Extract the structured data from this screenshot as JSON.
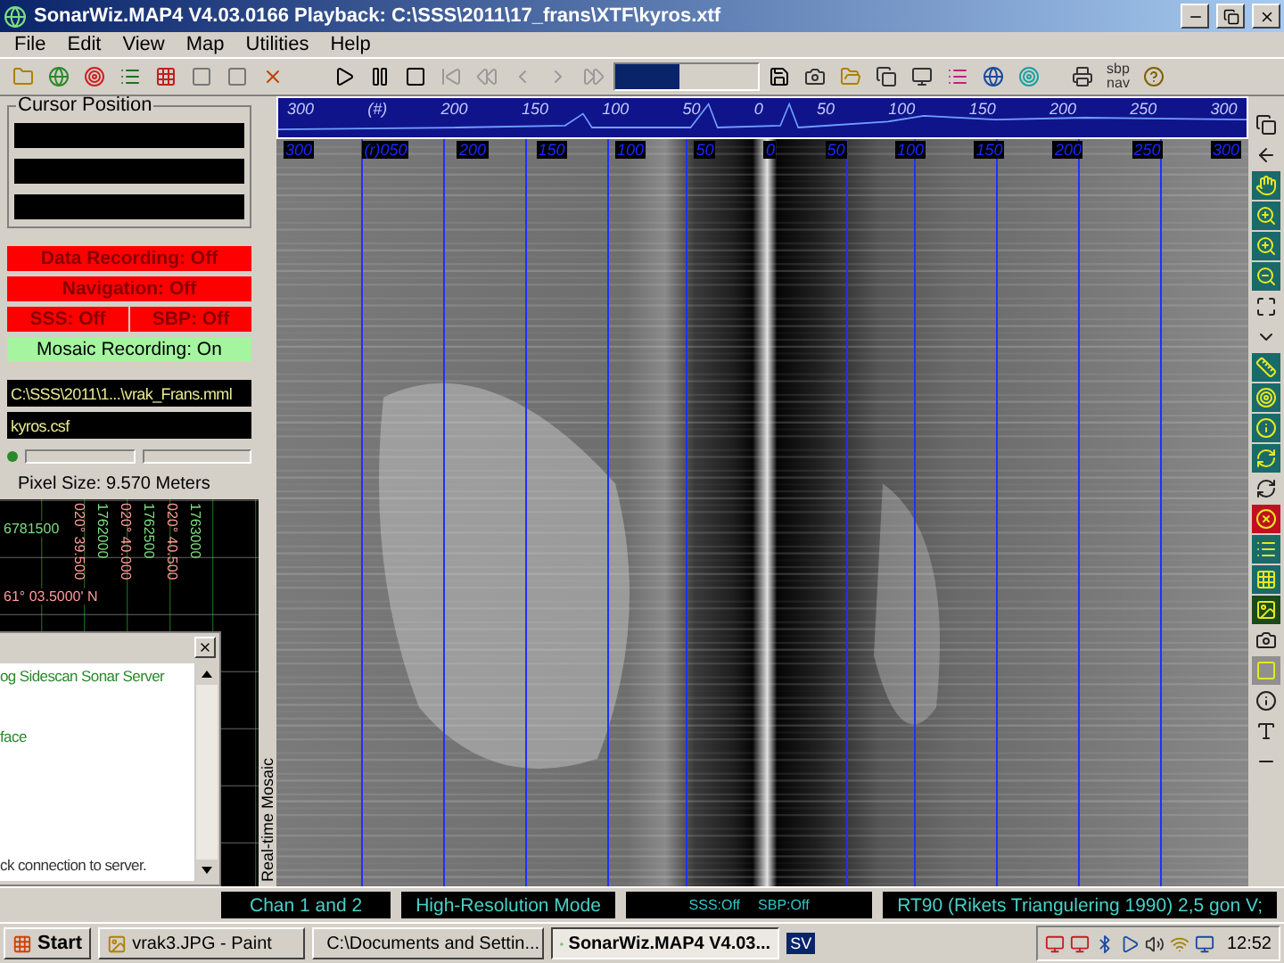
{
  "window": {
    "title": "SonarWiz.MAP4 V4.03.0166 Playback: C:\\SSS\\2011\\17_frans\\XTF\\kyros.xtf"
  },
  "menu": [
    "File",
    "Edit",
    "View",
    "Map",
    "Utilities",
    "Help"
  ],
  "toolbar": {
    "speed": {
      "level": 0.45
    },
    "sbp_nav": "sbp nav"
  },
  "waterfall": {
    "scale": [
      "300",
      "(#)",
      "200",
      "150",
      "100",
      "50",
      "0",
      "50",
      "100",
      "150",
      "200",
      "250",
      "300"
    ]
  },
  "sonar": {
    "scale": [
      "300",
      "(r)050",
      "200",
      "150",
      "100",
      "50",
      "0",
      "50",
      "100",
      "150",
      "200",
      "250",
      "300"
    ]
  },
  "cursor_position": {
    "title": "Cursor Position"
  },
  "status_rows": [
    {
      "cells": [
        {
          "label": "Data Recording: Off",
          "on": false
        }
      ]
    },
    {
      "cells": [
        {
          "label": "Navigation: Off",
          "on": false
        }
      ]
    },
    {
      "cells": [
        {
          "label": "SSS: Off",
          "on": false
        },
        {
          "label": "SBP: Off",
          "on": false
        }
      ]
    },
    {
      "cells": [
        {
          "label": "Mosaic Recording: On",
          "on": true
        }
      ]
    }
  ],
  "files": [
    "C:\\SSS\\2011\\1...\\vrak_Frans.mml",
    "kyros.csf"
  ],
  "progress": [
    {
      "level": 0
    },
    {
      "level": 0
    }
  ],
  "pixel_size": "Pixel Size: 9.570 Meters",
  "map": {
    "vertical_labels": [
      "020° 39.500",
      "1762000",
      "020° 40.000",
      "1762500",
      "020° 40.500",
      "1763000"
    ],
    "horizontal_labels": [
      "6781500",
      "61° 03.5000' N"
    ]
  },
  "dialog": {
    "lines": [
      "og Sidescan Sonar Server",
      "face",
      "ck connection to server."
    ]
  },
  "mosaic_tab": "Real-time Mosaic",
  "status_bar": [
    {
      "texts": [
        "Chan 1 and 2"
      ]
    },
    {
      "texts": [
        "High-Resolution Mode"
      ]
    },
    {
      "texts": [
        "SSS:Off",
        "SBP:Off"
      ]
    },
    {
      "texts": [
        "RT90 (Rikets Triangulering 1990) 2,5 gon V;"
      ]
    }
  ],
  "taskbar": {
    "start": "Start",
    "tasks": [
      {
        "label": "vrak3.JPG - Paint",
        "selected": false,
        "kind": "paint"
      },
      {
        "label": "C:\\Documents and Settin...",
        "selected": false,
        "kind": "folder"
      },
      {
        "label": "SonarWiz.MAP4 V4.03...",
        "selected": true,
        "kind": "app"
      }
    ],
    "language": "SV",
    "clock": "12:52"
  }
}
